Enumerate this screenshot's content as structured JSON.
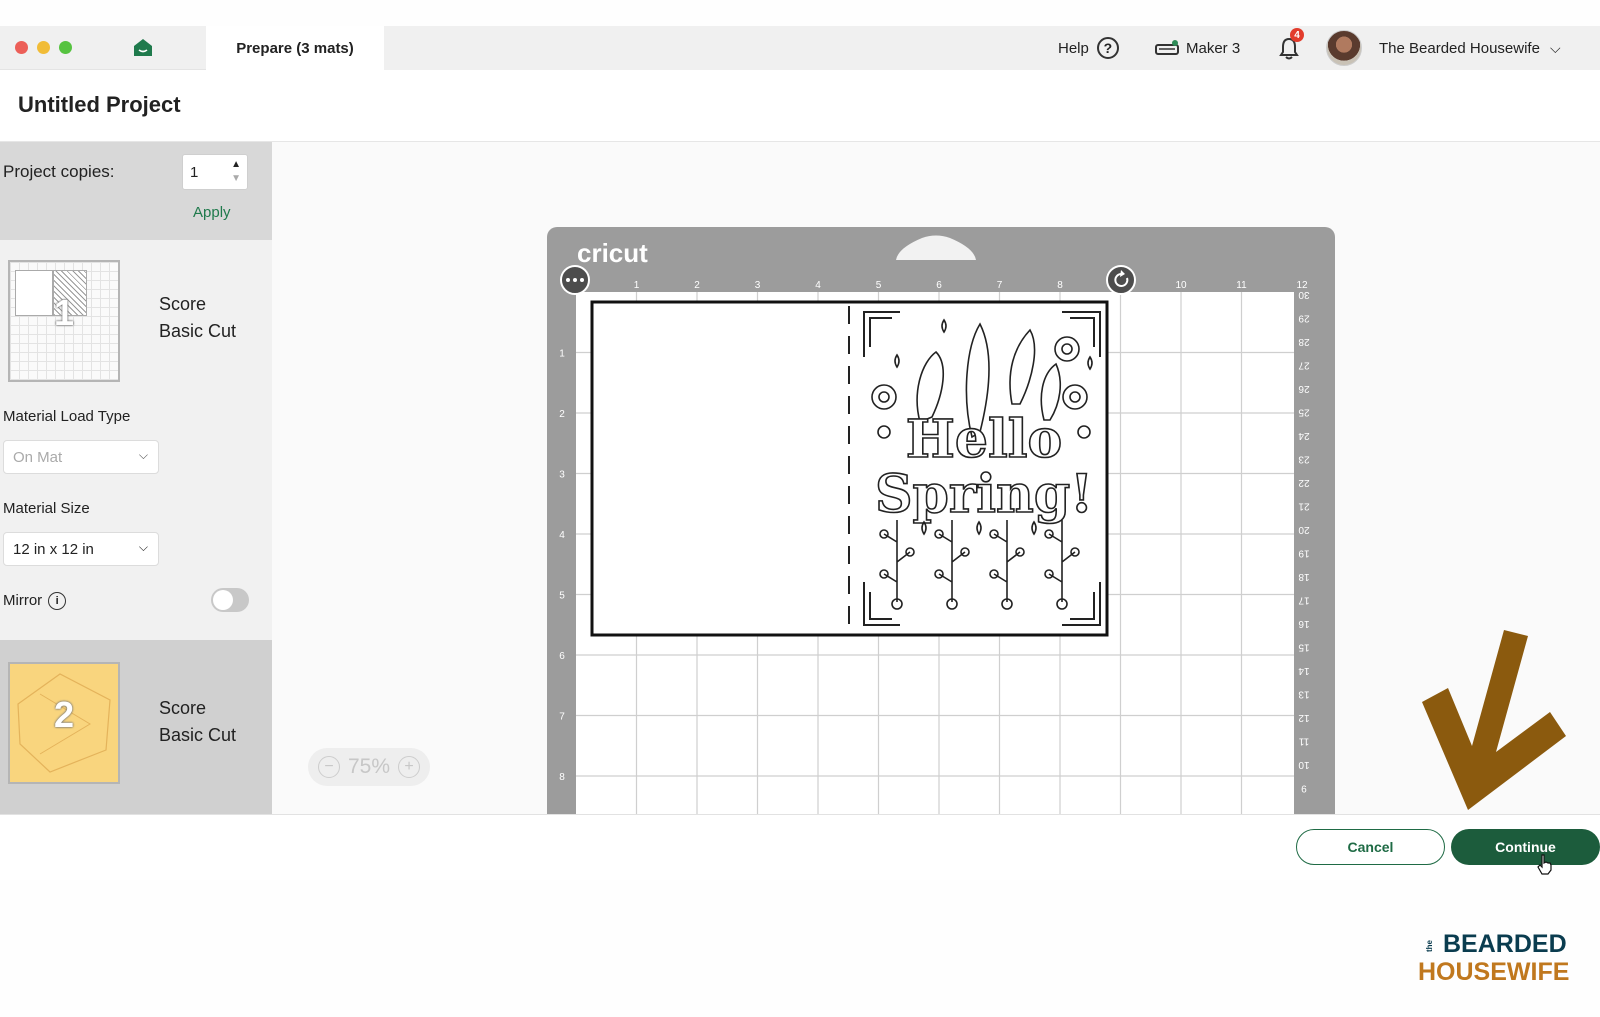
{
  "titlebar": {
    "tab_label": "Prepare (3 mats)",
    "help_label": "Help",
    "help_symbol": "?",
    "machine_label": "Maker 3",
    "notification_count": "4",
    "user_name": "The Bearded Housewife"
  },
  "project": {
    "title": "Untitled Project"
  },
  "panel": {
    "copies_label": "Project copies:",
    "copies_value": "1",
    "apply_label": "Apply",
    "mat1": {
      "number": "1",
      "line1": "Score",
      "line2": "Basic Cut"
    },
    "load_type_label": "Material Load Type",
    "load_type_value": "On Mat",
    "size_label": "Material Size",
    "size_value": "12 in x 12 in",
    "mirror_label": "Mirror",
    "mirror_on": false,
    "mat2": {
      "number": "2",
      "line1": "Score",
      "line2": "Basic Cut"
    }
  },
  "mat": {
    "brand": "cricut",
    "top_ruler": [
      "1",
      "2",
      "3",
      "4",
      "5",
      "6",
      "7",
      "8",
      "9",
      "10",
      "11",
      "12"
    ],
    "left_ruler": [
      "1",
      "2",
      "3",
      "4",
      "5",
      "6",
      "7",
      "8"
    ],
    "right_ruler": [
      "30",
      "29",
      "28",
      "27",
      "26",
      "25",
      "24",
      "23",
      "22",
      "21",
      "20",
      "19",
      "18",
      "17",
      "16",
      "15",
      "14",
      "13",
      "12",
      "11",
      "10",
      "9"
    ],
    "card_text_line1": "Hello",
    "card_text_line2": "Spring!"
  },
  "zoom": {
    "level": "75%",
    "minus": "−",
    "plus": "+"
  },
  "footer": {
    "cancel_label": "Cancel",
    "continue_label": "Continue"
  },
  "watermark": {
    "small": "the",
    "line1": "BEARDED",
    "line2": "HOUSEWIFE"
  },
  "colors": {
    "accent_green": "#1c5c3c",
    "mat_gray": "#9c9c9c",
    "mat2_yellow": "#f9d57e",
    "arrow_brown": "#8b5a0e"
  }
}
